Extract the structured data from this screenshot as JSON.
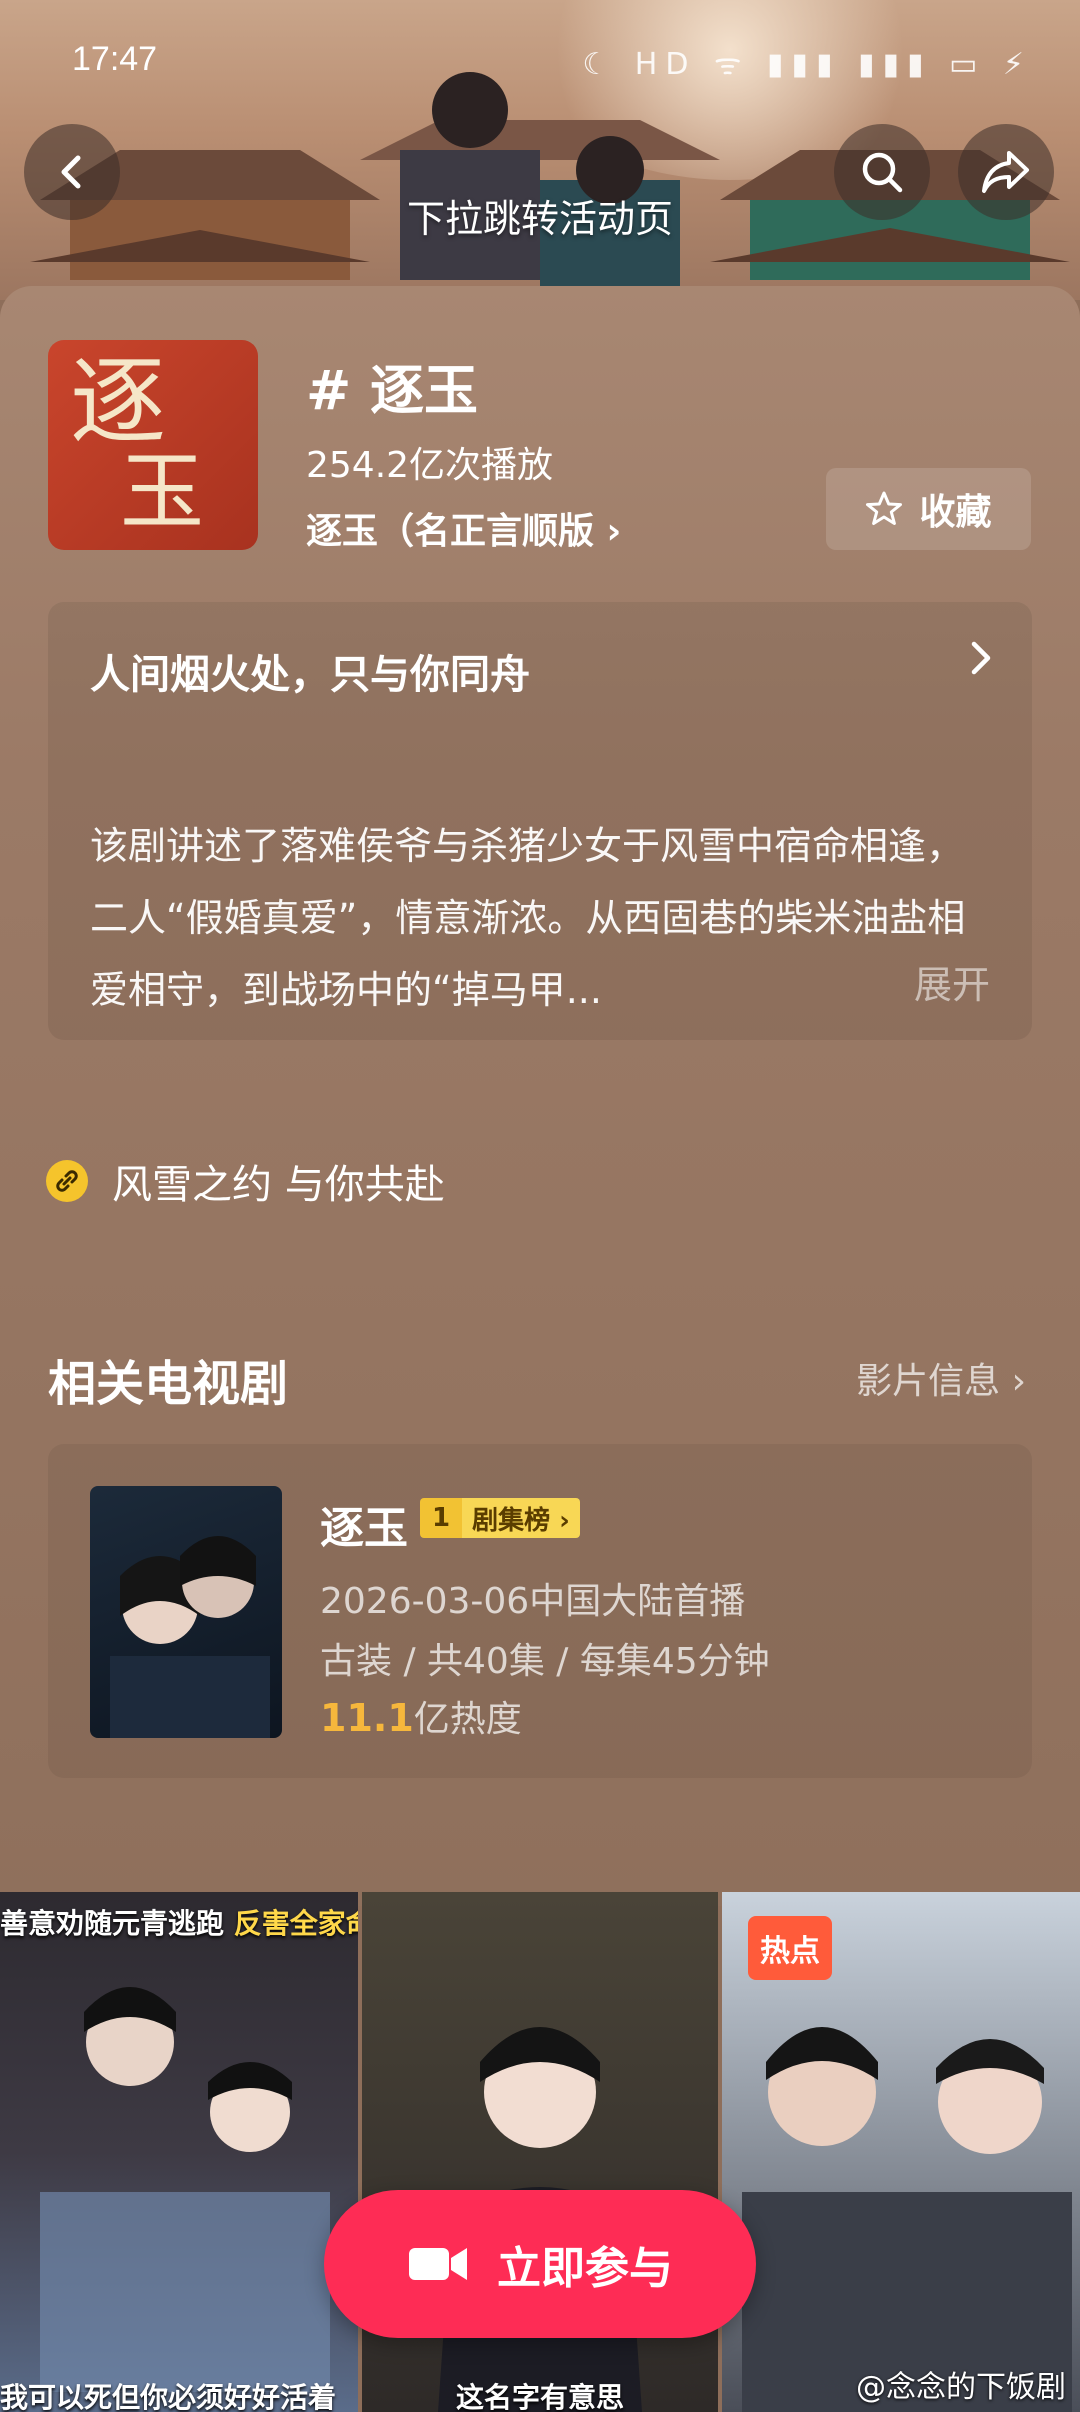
{
  "status": {
    "time": "17:47",
    "icons": "☾ HD ᯤ ▮▮▮ ▮▮▮ ▭ ⚡"
  },
  "banner": {
    "pull_hint": "下拉跳转活动页"
  },
  "topic": {
    "poster_text_1": "逐",
    "poster_text_2": "玉",
    "title": "# 逐玉",
    "plays": "254.2亿次播放",
    "sub_link": "逐玉（名正言顺版 ›",
    "favorite_label": "收藏"
  },
  "description": {
    "title": "人间烟火处，只与你同舟",
    "body": "该剧讲述了落难侯爷与杀猪少女于风雪中宿命相逢，二人“假婚真爱”，情意渐浓。从西固巷的柴米油盐相爱相守，到战场中的“掉马甲...",
    "expand": "展开"
  },
  "link_row": {
    "text": "风雪之约 与你共赴"
  },
  "related": {
    "section_title": "相关电视剧",
    "more_label": "影片信息 ›",
    "drama": {
      "name": "逐玉",
      "rank_num": "1",
      "rank_label": "剧集榜 ›",
      "date": "2026-03-06中国大陆首播",
      "meta": "古装 / 共40集 / 每集45分钟",
      "heat_num": "11.1",
      "heat_unit": "亿热度"
    }
  },
  "videos": {
    "tile1_caption_a": "善意劝随元青逃跑 ",
    "tile1_caption_b": "反害全家命丧",
    "tile1_bottom": "我可以死但你必须好好活着",
    "tile2_bottom": "这名字有意思",
    "tile3_tag": "热点"
  },
  "join_button": {
    "label": "立即参与"
  },
  "watermark": "@念念的下饭剧",
  "colors": {
    "accent": "#fe2c55",
    "sheet": "#9b7a66",
    "heat": "#f6b73c",
    "badge": "#f2c233"
  }
}
